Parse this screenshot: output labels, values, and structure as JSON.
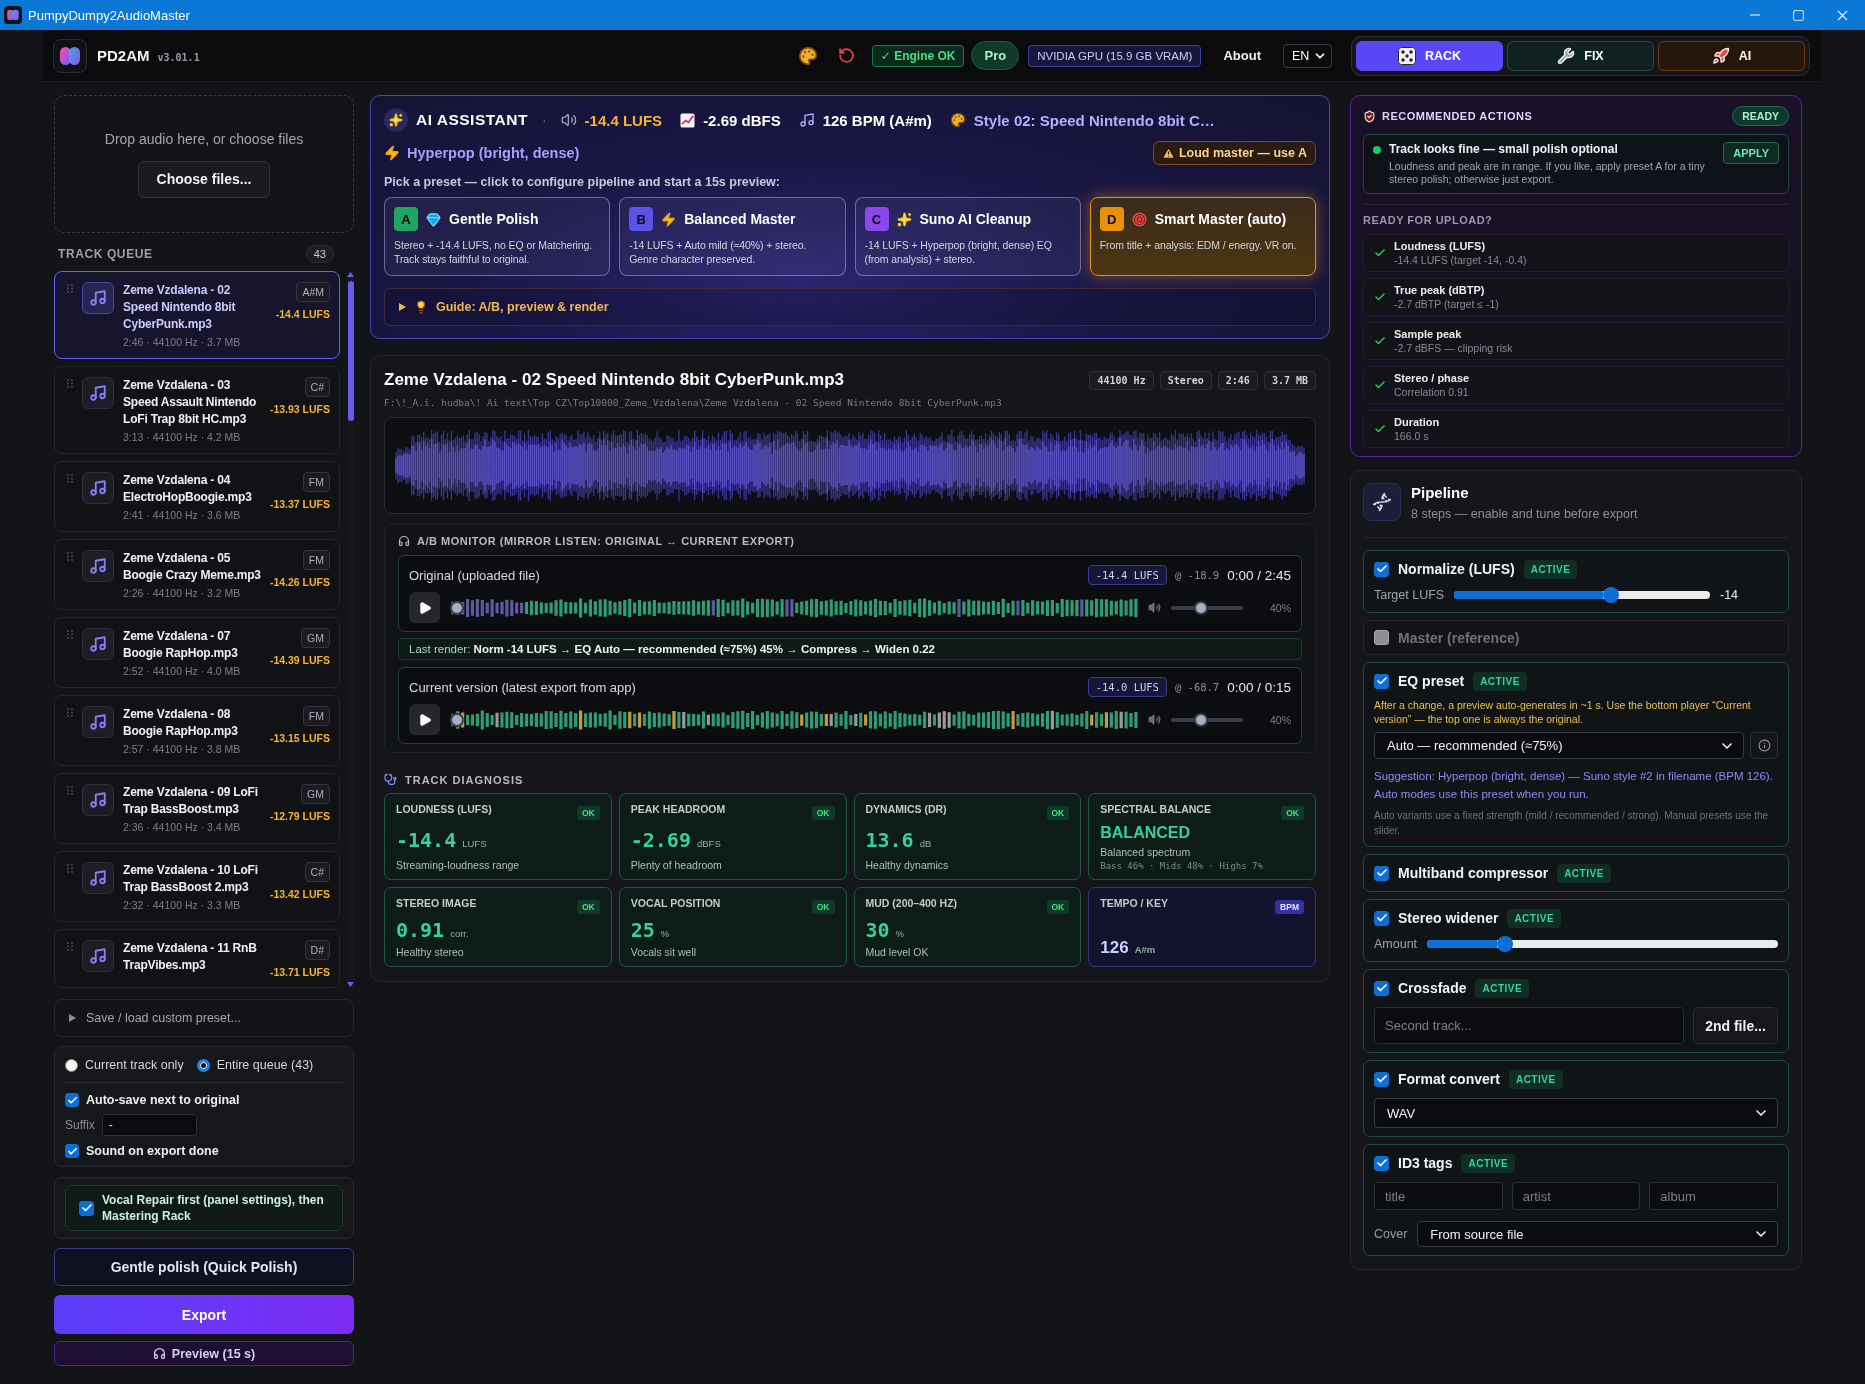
{
  "window": {
    "title": "PumpyDumpy2AudioMaster"
  },
  "header": {
    "app_name": "PD2AM",
    "version": "v3.01.1",
    "engine_status": "✓ Engine OK",
    "plan": "Pro",
    "gpu": "NVIDIA GPU (15.9 GB VRAM)",
    "about": "About",
    "language": "EN",
    "mode_tabs": [
      {
        "label": "RACK",
        "kind": "rack",
        "selected": true
      },
      {
        "label": "FIX",
        "kind": "fix",
        "selected": false
      },
      {
        "label": "AI",
        "kind": "ai",
        "selected": false
      }
    ]
  },
  "sidebar": {
    "drop_zone": {
      "text": "Drop audio here, or choose files",
      "button": "Choose files..."
    },
    "queue": {
      "title": "TRACK QUEUE",
      "count": "43",
      "tracks": [
        {
          "title": "Zeme Vzdalena - 02 Speed Nintendo 8bit CyberPunk.mp3",
          "meta": "2:46 · 44100 Hz · 3.7 MB",
          "key": "A#M",
          "loudness": "-14.4 LUFS",
          "selected": true
        },
        {
          "title": "Zeme Vzdalena - 03 Speed Assault Nintendo LoFi Trap 8bit HC.mp3",
          "meta": "3:13 · 44100 Hz · 4.2 MB",
          "key": "C#",
          "loudness": "-13.93 LUFS",
          "selected": false
        },
        {
          "title": "Zeme Vzdalena - 04 ElectroHopBoogie.mp3",
          "meta": "2:41 · 44100 Hz · 3.6 MB",
          "key": "FM",
          "loudness": "-13.37 LUFS",
          "selected": false
        },
        {
          "title": "Zeme Vzdalena - 05 Boogie Crazy Meme.mp3",
          "meta": "2:26 · 44100 Hz · 3.2 MB",
          "key": "FM",
          "loudness": "-14.26 LUFS",
          "selected": false
        },
        {
          "title": "Zeme Vzdalena - 07 Boogie RapHop.mp3",
          "meta": "2:52 · 44100 Hz · 4.0 MB",
          "key": "GM",
          "loudness": "-14.39 LUFS",
          "selected": false
        },
        {
          "title": "Zeme Vzdalena - 08 Boogie RapHop.mp3",
          "meta": "2:57 · 44100 Hz · 3.8 MB",
          "key": "FM",
          "loudness": "-13.15 LUFS",
          "selected": false
        },
        {
          "title": "Zeme Vzdalena - 09 LoFi Trap BassBoost.mp3",
          "meta": "2:36 · 44100 Hz · 3.4 MB",
          "key": "GM",
          "loudness": "-12.79 LUFS",
          "selected": false
        },
        {
          "title": "Zeme Vzdalena - 10 LoFi Trap BassBoost 2.mp3",
          "meta": "2:32 · 44100 Hz · 3.3 MB",
          "key": "C#",
          "loudness": "-13.42 LUFS",
          "selected": false
        },
        {
          "title": "Zeme Vzdalena - 11 RnB TrapVibes.mp3",
          "key": "D#",
          "loudness": "-13.71 LUFS",
          "selected": false
        }
      ]
    },
    "custom_preset": {
      "label": "Save / load custom preset...",
      "expanded": false
    },
    "scope_options": [
      {
        "label": "Current track only",
        "selected": false
      },
      {
        "label": "Entire queue (43)",
        "selected": true
      }
    ],
    "auto_save": {
      "label": "Auto-save next to original",
      "checked": true
    },
    "suffix": {
      "label": "Suffix",
      "value": "-"
    },
    "export_sound": {
      "label": "Sound on export done",
      "checked": true
    },
    "vocal_repair": {
      "label": "Vocal Repair first (panel settings), then Mastering Rack",
      "checked": true
    },
    "actions": [
      {
        "label": "Gentle polish (Quick Polish)",
        "kind": "secondary"
      },
      {
        "label": "Export",
        "kind": "primary"
      },
      {
        "label": "Preview (15 s)",
        "kind": "preview"
      }
    ]
  },
  "ai_assistant": {
    "title": "AI ASSISTANT",
    "separator": "·",
    "stats": [
      {
        "kind": "loudness",
        "text": "-14.4 LUFS"
      },
      {
        "kind": "peak",
        "text": "-2.69 dBFS"
      },
      {
        "kind": "tempo",
        "text": "126 BPM (A#m)"
      },
      {
        "kind": "style",
        "text": "Style 02: Speed Nintendo 8bit C…"
      }
    ],
    "genre": "Hyperpop (bright, dense)",
    "warning": "Loud master — use A",
    "prompt": "Pick a preset — click to configure pipeline and start a 15s preview:",
    "presets": [
      {
        "letter": "A",
        "kind": "gem",
        "title": "Gentle Polish",
        "description": "Stereo + -14.4 LUFS, no EQ or Matchering. Track stays faithful to original.",
        "color": "#1fa463",
        "selected": false
      },
      {
        "letter": "B",
        "kind": "bolt",
        "title": "Balanced Master",
        "description": "-14 LUFS + Auto mild (≈40%) + stereo. Genre character preserved.",
        "color": "#5b52e8",
        "selected": false
      },
      {
        "letter": "C",
        "kind": "sparkles",
        "title": "Suno AI Cleanup",
        "description": "-14 LUFS + Hyperpop (bright, dense) EQ (from analysis) + stereo.",
        "color": "#8b46f0",
        "selected": false
      },
      {
        "letter": "D",
        "kind": "target",
        "title": "Smart Master (auto)",
        "description": "From title + analysis: EDM / energy. VR on.",
        "color": "#e8920c",
        "selected": true
      }
    ],
    "guide": {
      "label": "Guide: A/B, preview & render",
      "expanded": false
    }
  },
  "track": {
    "title": "Zeme Vzdalena - 02 Speed Nintendo 8bit CyberPunk.mp3",
    "tags": [
      "44100 Hz",
      "Stereo",
      "2:46",
      "3.7 MB"
    ],
    "path": "F:\\!_A.i. hudba\\! Ai text\\Top CZ\\Top10000_Zeme_Vzdalena\\Zeme Vzdalena - 02 Speed Nintendo 8bit CyberPunk.mp3",
    "ab_monitor": {
      "title": "A/B MONITOR (MIRROR LISTEN: ORIGINAL ↔ CURRENT EXPORT)",
      "original_player": {
        "label": "Original (uploaded file)",
        "loudness": "-14.4 LUFS",
        "peak": "@ -18.9",
        "time": "0:00 / 2:45",
        "level": 0,
        "volume": {
          "level": 0.4,
          "reading": "40%"
        }
      },
      "last_render": "Last render: **Norm -14 LUFS → EQ Auto — recommended (≈75%) 45% → Compress → Widen 0.22**",
      "current_player": {
        "label": "Current version (latest export from app)",
        "loudness": "-14.0 LUFS",
        "peak": "@ -68.7",
        "time": "0:00 / 0:15",
        "level": 0,
        "volume": {
          "level": 0.4,
          "reading": "40%"
        }
      }
    }
  },
  "diagnosis": {
    "title": "TRACK DIAGNOSIS",
    "cards": [
      {
        "kind": "metric",
        "label": "LOUDNESS (LUFS)",
        "badge": "OK",
        "value": "-14.4",
        "unit": "LUFS",
        "note": "Streaming-loudness range"
      },
      {
        "kind": "metric",
        "label": "PEAK HEADROOM",
        "badge": "OK",
        "value": "-2.69",
        "unit": "dBFS",
        "note": "Plenty of headroom"
      },
      {
        "kind": "metric",
        "label": "DYNAMICS (DR)",
        "badge": "OK",
        "value": "13.6",
        "unit": "dB",
        "note": "Healthy dynamics"
      },
      {
        "kind": "verdict",
        "label": "SPECTRAL BALANCE",
        "badge": "OK",
        "value": "BALANCED",
        "note": "Balanced spectrum",
        "detail": "Bass 46% · Mids 48% · Highs 7%"
      },
      {
        "kind": "metric",
        "label": "STEREO IMAGE",
        "badge": "OK",
        "value": "0.91",
        "unit": "corr.",
        "note": "Healthy stereo"
      },
      {
        "kind": "metric",
        "label": "VOCAL POSITION",
        "badge": "OK",
        "value": "25",
        "unit": "%",
        "note": "Vocals sit well"
      },
      {
        "kind": "metric",
        "label": "MUD (200–400 HZ)",
        "badge": "OK",
        "value": "30",
        "unit": "%",
        "note": "Mud level OK"
      },
      {
        "kind": "tempo",
        "label": "TEMPO / KEY",
        "badge": "BPM",
        "value": "126",
        "unit": "A#m"
      }
    ]
  },
  "recommendations": {
    "title": "RECOMMENDED ACTIONS",
    "badge": "READY",
    "action": {
      "title": "Track looks fine — small polish optional",
      "description": "Loudness and peak are in range. If you like, apply preset A for a tiny stereo polish; otherwise just export.",
      "button": "APPLY"
    },
    "checklist_title": "READY FOR UPLOAD?",
    "checks": [
      {
        "label": "Loudness (LUFS)",
        "detail": "-14.4 LUFS (target -14, -0.4)",
        "passed": true
      },
      {
        "label": "True peak (dBTP)",
        "detail": "-2.7 dBTP (target ≤ -1)",
        "passed": true
      },
      {
        "label": "Sample peak",
        "detail": "-2.7 dBFS — clipping risk",
        "passed": true
      },
      {
        "label": "Stereo / phase",
        "detail": "Correlation 0.91",
        "passed": true
      },
      {
        "label": "Duration",
        "detail": "166.0 s",
        "passed": true
      }
    ]
  },
  "pipeline": {
    "title": "Pipeline",
    "subtitle": "8 steps — enable and tune before export",
    "steps": [
      {
        "kind": "slider",
        "label": "Normalize (LUFS)",
        "checked": true,
        "badge": "ACTIVE",
        "slider_label": "Target LUFS",
        "level": 0.62,
        "reading": "-14"
      },
      {
        "kind": "plain",
        "label": "Master (reference)",
        "checked": false
      },
      {
        "kind": "eq",
        "label": "EQ preset",
        "checked": true,
        "badge": "ACTIVE",
        "notice": "After a change, a preview auto-generates in ~1 s. Use the bottom player “Current version” — the top one is always the original.",
        "select": "Auto — recommended (≈75%)",
        "suggestion": "Suggestion: Hyperpop (bright, dense) — Suno style #2 in filename (BPM 126). Auto modes use this preset when you run.",
        "hint": "Auto variants use a fixed strength (mild / recommended / strong). Manual presets use the slider."
      },
      {
        "kind": "plain",
        "label": "Multiband compressor",
        "checked": true,
        "badge": "ACTIVE"
      },
      {
        "kind": "slider",
        "label": "Stereo widener",
        "checked": true,
        "badge": "ACTIVE",
        "slider_label": "Amount",
        "level": 0.21
      },
      {
        "kind": "file",
        "label": "Crossfade",
        "checked": true,
        "badge": "ACTIVE",
        "placeholder": "Second track...",
        "button": "2nd file..."
      },
      {
        "kind": "select",
        "label": "Format convert",
        "checked": true,
        "badge": "ACTIVE",
        "select": "WAV"
      },
      {
        "kind": "tags",
        "label": "ID3 tags",
        "checked": true,
        "badge": "ACTIVE",
        "fields": [
          {
            "placeholder": "title"
          },
          {
            "placeholder": "artist"
          },
          {
            "placeholder": "album"
          }
        ],
        "cover_label": "Cover",
        "cover": "From source file"
      }
    ]
  }
}
